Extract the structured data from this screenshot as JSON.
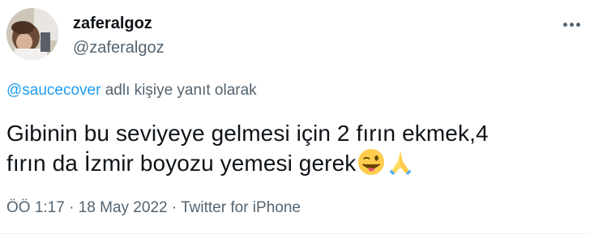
{
  "user": {
    "display_name": "zaferalgoz",
    "handle": "@zaferalgoz"
  },
  "reply": {
    "mention": "@saucecover",
    "suffix": " adlı kişiye yanıt olarak"
  },
  "tweet": {
    "line1": "Gibinin bu seviyeye gelmesi için 2 fırın ekmek,4",
    "line2": "fırın da İzmir boyozu yemesi gerek",
    "emojis": [
      "winking-face-with-tongue",
      "folded-hands"
    ]
  },
  "meta": {
    "time": "ÖÖ 1:17",
    "date": "18 May 2022",
    "source": "Twitter for iPhone",
    "separator": " · "
  },
  "colors": {
    "text": "#0f1419",
    "secondary": "#536471",
    "link": "#1d9bf0"
  },
  "icons": {
    "more": "more-options-icon"
  }
}
